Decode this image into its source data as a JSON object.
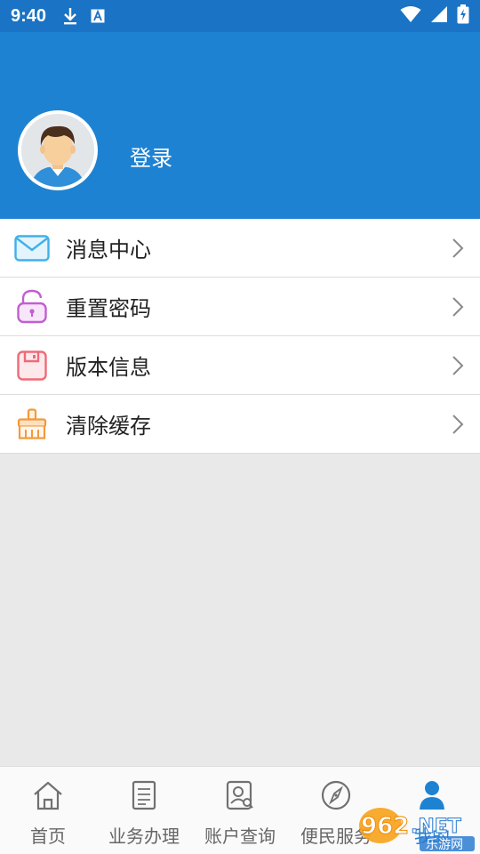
{
  "status_bar": {
    "time": "9:40",
    "icons": [
      "download-icon",
      "a-icon",
      "wifi-icon",
      "signal-icon",
      "battery-icon"
    ]
  },
  "profile": {
    "login_label": "登录",
    "avatar_icon": "user-avatar-icon"
  },
  "menu": {
    "items": [
      {
        "label": "消息中心",
        "icon": "envelope-icon"
      },
      {
        "label": "重置密码",
        "icon": "unlock-icon"
      },
      {
        "label": "版本信息",
        "icon": "save-icon"
      },
      {
        "label": "清除缓存",
        "icon": "brush-icon"
      }
    ]
  },
  "bottom_nav": {
    "items": [
      {
        "label": "首页",
        "icon": "home-icon"
      },
      {
        "label": "业务办理",
        "icon": "document-icon"
      },
      {
        "label": "账户查询",
        "icon": "account-search-icon"
      },
      {
        "label": "便民服务",
        "icon": "compass-icon"
      },
      {
        "label": "我的",
        "icon": "person-icon"
      }
    ],
    "active_index": 4
  },
  "watermark": {
    "brand": "962.NET",
    "sub": "乐游网"
  },
  "colors": {
    "header_blue": "#1e82d2",
    "status_blue": "#1a73c4",
    "background": "#e9e9e9",
    "active": "#1e82d2"
  }
}
